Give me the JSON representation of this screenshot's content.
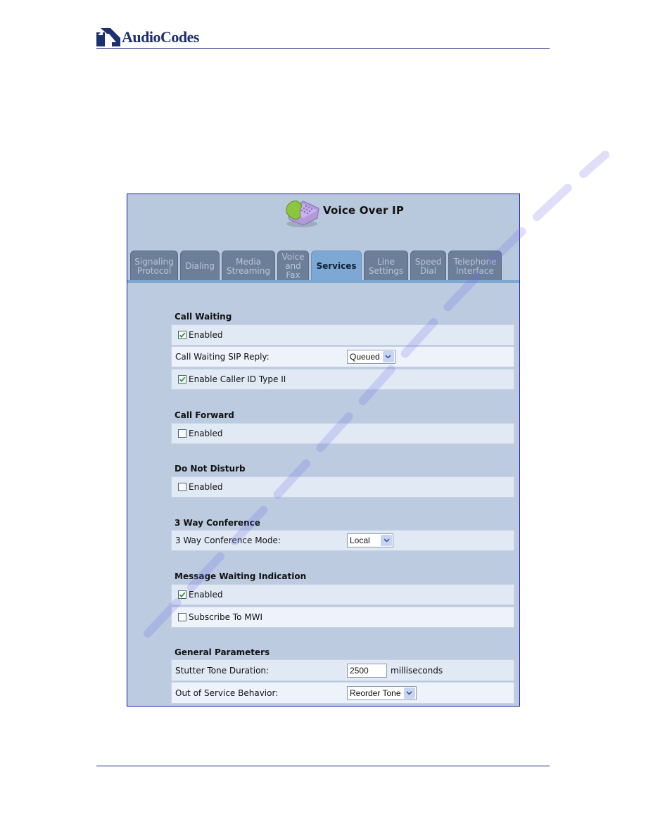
{
  "document": {
    "brand": "AudioCodes",
    "brand_color": "#1c2f6e",
    "rule_color": "#1a1a7a"
  },
  "app": {
    "title": "Voice Over IP",
    "icon": "voip-phone-icon"
  },
  "tabs": [
    {
      "label": "Signaling\nProtocol",
      "active": false
    },
    {
      "label": "Dialing",
      "active": false
    },
    {
      "label": "Media\nStreaming",
      "active": false
    },
    {
      "label": "Voice\nand\nFax",
      "active": false
    },
    {
      "label": "Services",
      "active": true
    },
    {
      "label": "Line\nSettings",
      "active": false
    },
    {
      "label": "Speed\nDial",
      "active": false
    },
    {
      "label": "Telephone\nInterface",
      "active": false
    }
  ],
  "sections": {
    "call_waiting": {
      "title": "Call Waiting",
      "enabled": {
        "label": "Enabled",
        "checked": true
      },
      "sip_reply": {
        "label": "Call Waiting SIP Reply:",
        "value": "Queued"
      },
      "caller_id_type2": {
        "label": "Enable Caller ID Type II",
        "checked": true
      }
    },
    "call_forward": {
      "title": "Call Forward",
      "enabled": {
        "label": "Enabled",
        "checked": false
      }
    },
    "do_not_disturb": {
      "title": "Do Not Disturb",
      "enabled": {
        "label": "Enabled",
        "checked": false
      }
    },
    "three_way": {
      "title": "3 Way Conference",
      "mode": {
        "label": "3 Way Conference Mode:",
        "value": "Local"
      }
    },
    "mwi": {
      "title": "Message Waiting Indication",
      "enabled": {
        "label": "Enabled",
        "checked": true
      },
      "subscribe": {
        "label": "Subscribe To MWI",
        "checked": false
      }
    },
    "general": {
      "title": "General Parameters",
      "stutter": {
        "label": "Stutter Tone Duration:",
        "value": "2500",
        "unit": "milliseconds"
      },
      "out_of_service": {
        "label": "Out of Service Behavior:",
        "value": "Reorder Tone"
      }
    }
  },
  "colors": {
    "active_tab": "#7ea8d4",
    "inactive_tab": "#6d7e98",
    "panel_bg": "#bccbe0",
    "check_green": "#2e9e2e"
  }
}
